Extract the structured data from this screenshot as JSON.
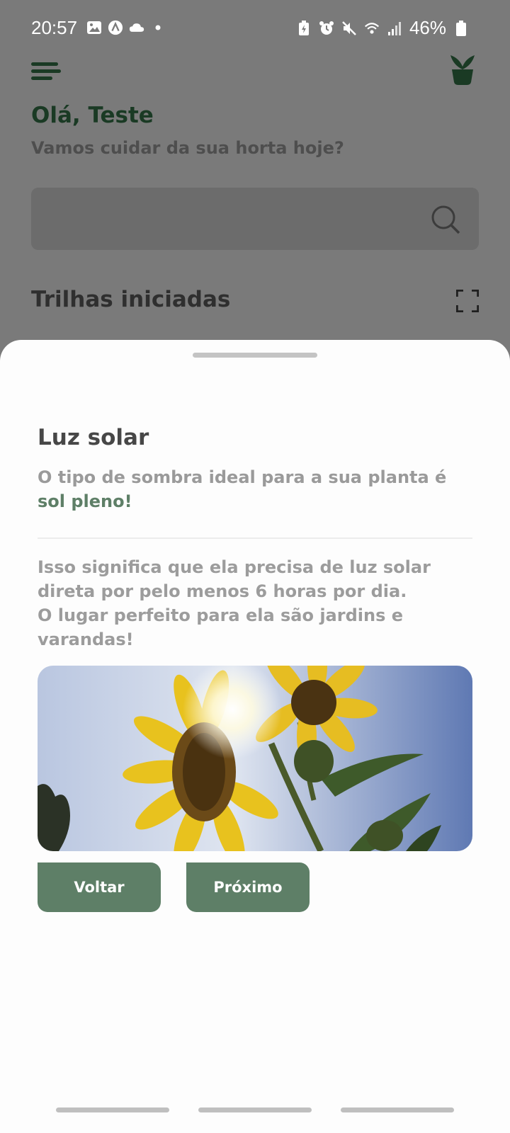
{
  "status_bar": {
    "time": "20:57",
    "battery": "46%",
    "left_icons": [
      "image-icon",
      "app-a-icon",
      "cloud-icon",
      "dot-icon"
    ],
    "right_icons": [
      "battery-saver-icon",
      "alarm-icon",
      "mute-icon",
      "wifi-icon",
      "signal-icon",
      "battery-icon"
    ]
  },
  "header": {
    "greeting": "Olá, Teste",
    "subtitle": "Vamos cuidar da sua horta hoje?"
  },
  "search": {
    "placeholder": ""
  },
  "section": {
    "title": "Trilhas iniciadas"
  },
  "sheet": {
    "title": "Luz solar",
    "lead_text": "O tipo de sombra ideal para a sua planta é ",
    "lead_highlight": "sol pleno!",
    "body_line1": "Isso significa que ela precisa de luz solar direta por pelo menos 6 horas por dia.",
    "body_line2": "O lugar perfeito para ela são jardins e varandas!",
    "back_label": "Voltar",
    "next_label": "Próximo"
  },
  "colors": {
    "accent": "#5e7f67",
    "dark_green": "#1a3a24",
    "overlay": "#7a7a7a"
  }
}
